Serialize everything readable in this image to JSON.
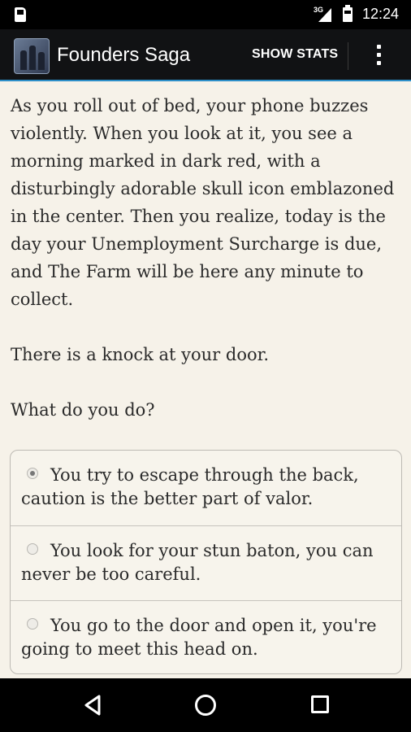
{
  "status_bar": {
    "network_type": "3G",
    "time": "12:24"
  },
  "action_bar": {
    "app_title": "Founders Saga",
    "show_stats_label": "SHOW STATS",
    "accent_color": "#2d8fc9"
  },
  "story": {
    "paragraph_1": "As you roll out of bed, your phone buzzes violently. When you look at it, you see a morning marked in dark red, with a disturbingly adorable skull icon emblazoned in the center. Then you realize, today is the day your Unemployment Surcharge is due, and The Farm will be here any minute to collect.",
    "paragraph_2": "There is a knock at your door.",
    "paragraph_3": "What do you do?"
  },
  "choices": [
    {
      "label": "You try to escape through the back, caution is the better part of valor.",
      "selected": true
    },
    {
      "label": "You look for your stun baton, you can never be too careful.",
      "selected": false
    },
    {
      "label": "You go to the door and open it, you're going to meet this head on.",
      "selected": false
    }
  ],
  "icons": {
    "status": [
      "sim-card-icon",
      "signal-icon",
      "battery-icon"
    ],
    "action_bar": [
      "app-icon",
      "overflow-menu-icon"
    ],
    "navigation": [
      "back-icon",
      "home-icon",
      "recents-icon"
    ]
  }
}
